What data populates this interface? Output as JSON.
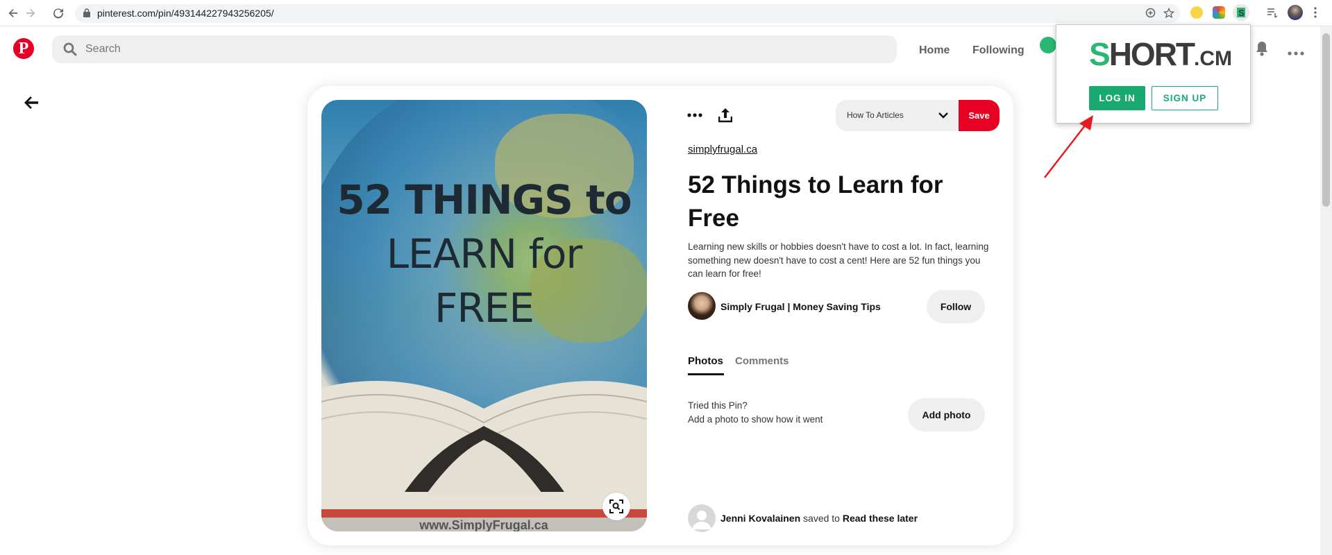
{
  "browser": {
    "url": "pinterest.com/pin/493144227943256205/",
    "back_icon": "arrow-left-icon",
    "forward_icon": "arrow-right-icon",
    "reload_icon": "reload-icon",
    "lock_icon": "lock-icon"
  },
  "header": {
    "logo_letter": "P",
    "search_placeholder": "Search",
    "nav": [
      "Home",
      "Following"
    ],
    "brand_color": "#e60023"
  },
  "pin": {
    "image_text": {
      "line1": "52 THINGS to",
      "line2": "LEARN for",
      "line3": "FREE",
      "watermark": "www.SimplyFrugal.ca"
    },
    "board_select": "How To Articles",
    "save_label": "Save",
    "domain": "simplyfrugal.ca",
    "title": "52 Things to Learn for Free",
    "description": "Learning new skills or hobbies doesn't have to cost a lot. In fact, learning something new doesn't have to cost a cent! Here are 52 fun things you can learn for free!",
    "author": "Simply Frugal | Money Saving Tips",
    "follow_label": "Follow",
    "tabs": [
      "Photos",
      "Comments"
    ],
    "tried_line1": "Tried this Pin?",
    "tried_line2": "Add a photo to show how it went",
    "add_photo_label": "Add photo",
    "saved_by": "Jenni Kovalainen",
    "saved_to_word": "saved to",
    "saved_board": "Read these later"
  },
  "popup": {
    "logo_s": "S",
    "logo_main": "HORT",
    "logo_suffix": ".CM",
    "login_label": "LOG IN",
    "signup_label": "SIGN UP",
    "accent_color": "#1aa971"
  }
}
